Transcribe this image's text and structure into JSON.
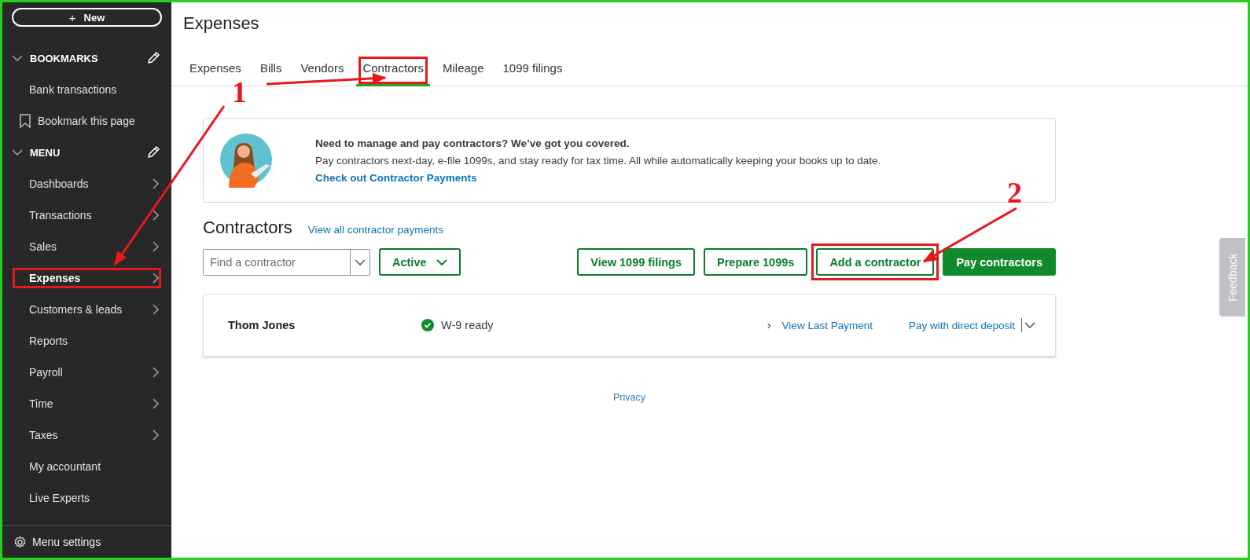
{
  "sidebar": {
    "new_button": {
      "icon": "+",
      "label": "New"
    },
    "sections": [
      {
        "title": "BOOKMARKS",
        "expanded": true,
        "items": [
          {
            "label": "Bank transactions",
            "kind": "link",
            "has_submenu": false,
            "selected": false,
            "highlighted": false
          },
          {
            "label": "Bookmark this page",
            "kind": "bookmark",
            "has_submenu": false,
            "selected": false,
            "highlighted": false
          }
        ]
      },
      {
        "title": "MENU",
        "expanded": true,
        "items": [
          {
            "label": "Dashboards",
            "kind": "link",
            "has_submenu": true,
            "selected": false,
            "highlighted": false
          },
          {
            "label": "Transactions",
            "kind": "link",
            "has_submenu": true,
            "selected": false,
            "highlighted": false
          },
          {
            "label": "Sales",
            "kind": "link",
            "has_submenu": true,
            "selected": false,
            "highlighted": false
          },
          {
            "label": "Expenses",
            "kind": "link",
            "has_submenu": true,
            "selected": true,
            "highlighted": true
          },
          {
            "label": "Customers & leads",
            "kind": "link",
            "has_submenu": true,
            "selected": false,
            "highlighted": false
          },
          {
            "label": "Reports",
            "kind": "link",
            "has_submenu": false,
            "selected": false,
            "highlighted": false
          },
          {
            "label": "Payroll",
            "kind": "link",
            "has_submenu": true,
            "selected": false,
            "highlighted": false
          },
          {
            "label": "Time",
            "kind": "link",
            "has_submenu": true,
            "selected": false,
            "highlighted": false
          },
          {
            "label": "Taxes",
            "kind": "link",
            "has_submenu": true,
            "selected": false,
            "highlighted": false
          },
          {
            "label": "My accountant",
            "kind": "link",
            "has_submenu": false,
            "selected": false,
            "highlighted": false
          },
          {
            "label": "Live Experts",
            "kind": "link",
            "has_submenu": false,
            "selected": false,
            "highlighted": false
          }
        ]
      }
    ],
    "settings": "Menu settings"
  },
  "page_title": "Expenses",
  "tabs": [
    {
      "label": "Expenses",
      "selected": false,
      "highlighted": false
    },
    {
      "label": "Bills",
      "selected": false,
      "highlighted": false
    },
    {
      "label": "Vendors",
      "selected": false,
      "highlighted": false
    },
    {
      "label": "Contractors",
      "selected": true,
      "highlighted": true
    },
    {
      "label": "Mileage",
      "selected": false,
      "highlighted": false
    },
    {
      "label": "1099 filings",
      "selected": false,
      "highlighted": false
    }
  ],
  "promo": {
    "heading": "Need to manage and pay contractors? We’ve got you covered.",
    "body": "Pay contractors next-day, e-file 1099s, and stay ready for tax time. All while automatically keeping your books up to date.",
    "link": "Check out Contractor Payments"
  },
  "section": {
    "title": "Contractors",
    "link": "View all contractor payments"
  },
  "search": {
    "placeholder": "Find a contractor"
  },
  "filter": {
    "label": "Active"
  },
  "buttons": [
    {
      "label": "View 1099 filings",
      "kind": "secondary",
      "highlighted": false
    },
    {
      "label": "Prepare 1099s",
      "kind": "secondary",
      "highlighted": false
    },
    {
      "label": "Add a contractor",
      "kind": "secondary",
      "highlighted": true
    },
    {
      "label": "Pay contractors",
      "kind": "primary",
      "highlighted": false
    }
  ],
  "contractors": [
    {
      "name": "Thom Jones",
      "status": "W-9 ready",
      "chevron": "›",
      "link": "View Last Payment",
      "action": "Pay with direct deposit"
    }
  ],
  "footer_link": "Privacy",
  "feedback": "Feedback",
  "annotations": [
    {
      "label": "1"
    },
    {
      "label": "2"
    }
  ]
}
